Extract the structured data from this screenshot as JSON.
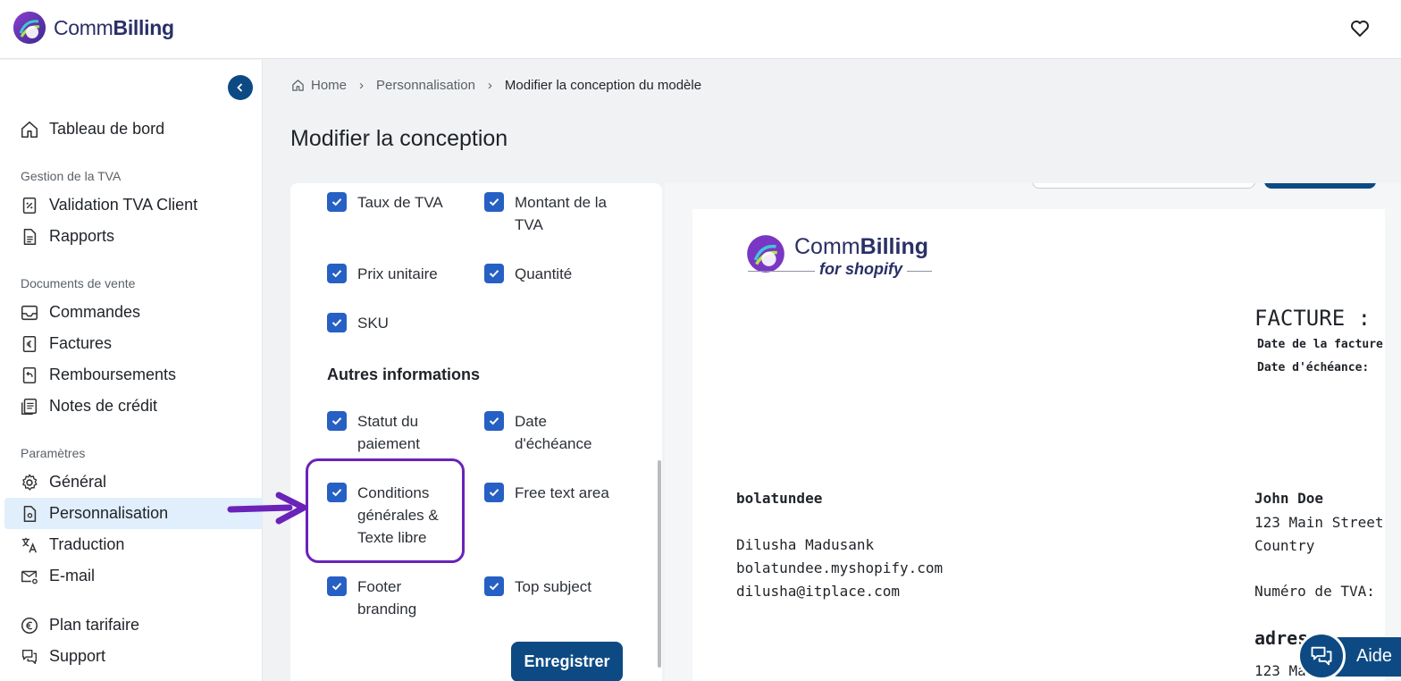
{
  "brand": {
    "name_light": "Comm",
    "name_bold": "Billing"
  },
  "breadcrumb": {
    "home": "Home",
    "level1": "Personnalisation",
    "current": "Modifier la conception du modèle"
  },
  "page_title": "Modifier la conception",
  "sidebar": {
    "dashboard": "Tableau de bord",
    "section_vat": "Gestion de la TVA",
    "vat_validation": "Validation TVA Client",
    "reports": "Rapports",
    "section_sales": "Documents de vente",
    "orders": "Commandes",
    "invoices": "Factures",
    "refunds": "Remboursements",
    "credit_notes": "Notes de crédit",
    "section_settings": "Paramètres",
    "general": "Général",
    "customization": "Personnalisation",
    "translation": "Traduction",
    "email": "E-mail",
    "pricing": "Plan tarifaire",
    "support": "Support"
  },
  "options": {
    "vat_rate": "Taux de TVA",
    "vat_amount": "Montant de la TVA",
    "unit_price": "Prix unitaire",
    "quantity": "Quantité",
    "sku": "SKU",
    "other_info_heading": "Autres informations",
    "payment_status": "Statut du paiement",
    "due_date": "Date d'échéance",
    "terms": "Conditions générales & Texte libre",
    "free_text": "Free text area",
    "footer_branding": "Footer branding",
    "top_subject": "Top subject"
  },
  "save_label": "Enregistrer",
  "invoice": {
    "logo_light": "Comm",
    "logo_bold": "Billing",
    "logo_sub": "for shopify",
    "title": "FACTURE :",
    "invoice_date": "Date de la facture",
    "due_date": "Date d'échéance:",
    "shop_name": "bolatundee",
    "contact": "Dilusha Madusank",
    "domain": "bolatundee.myshopify.com",
    "email": "dilusha@itplace.com",
    "customer_name": "John Doe",
    "customer_street": "123 Main Street",
    "customer_country": "Country",
    "vat_number": "Numéro de TVA:",
    "address_heading": "adres",
    "address_line": "123 Ma"
  },
  "help_label": "Aide",
  "colors": {
    "primary": "#0d4a83",
    "checkbox": "#2660c4",
    "highlight": "#6a22b8",
    "active_nav": "#e1eefb"
  }
}
